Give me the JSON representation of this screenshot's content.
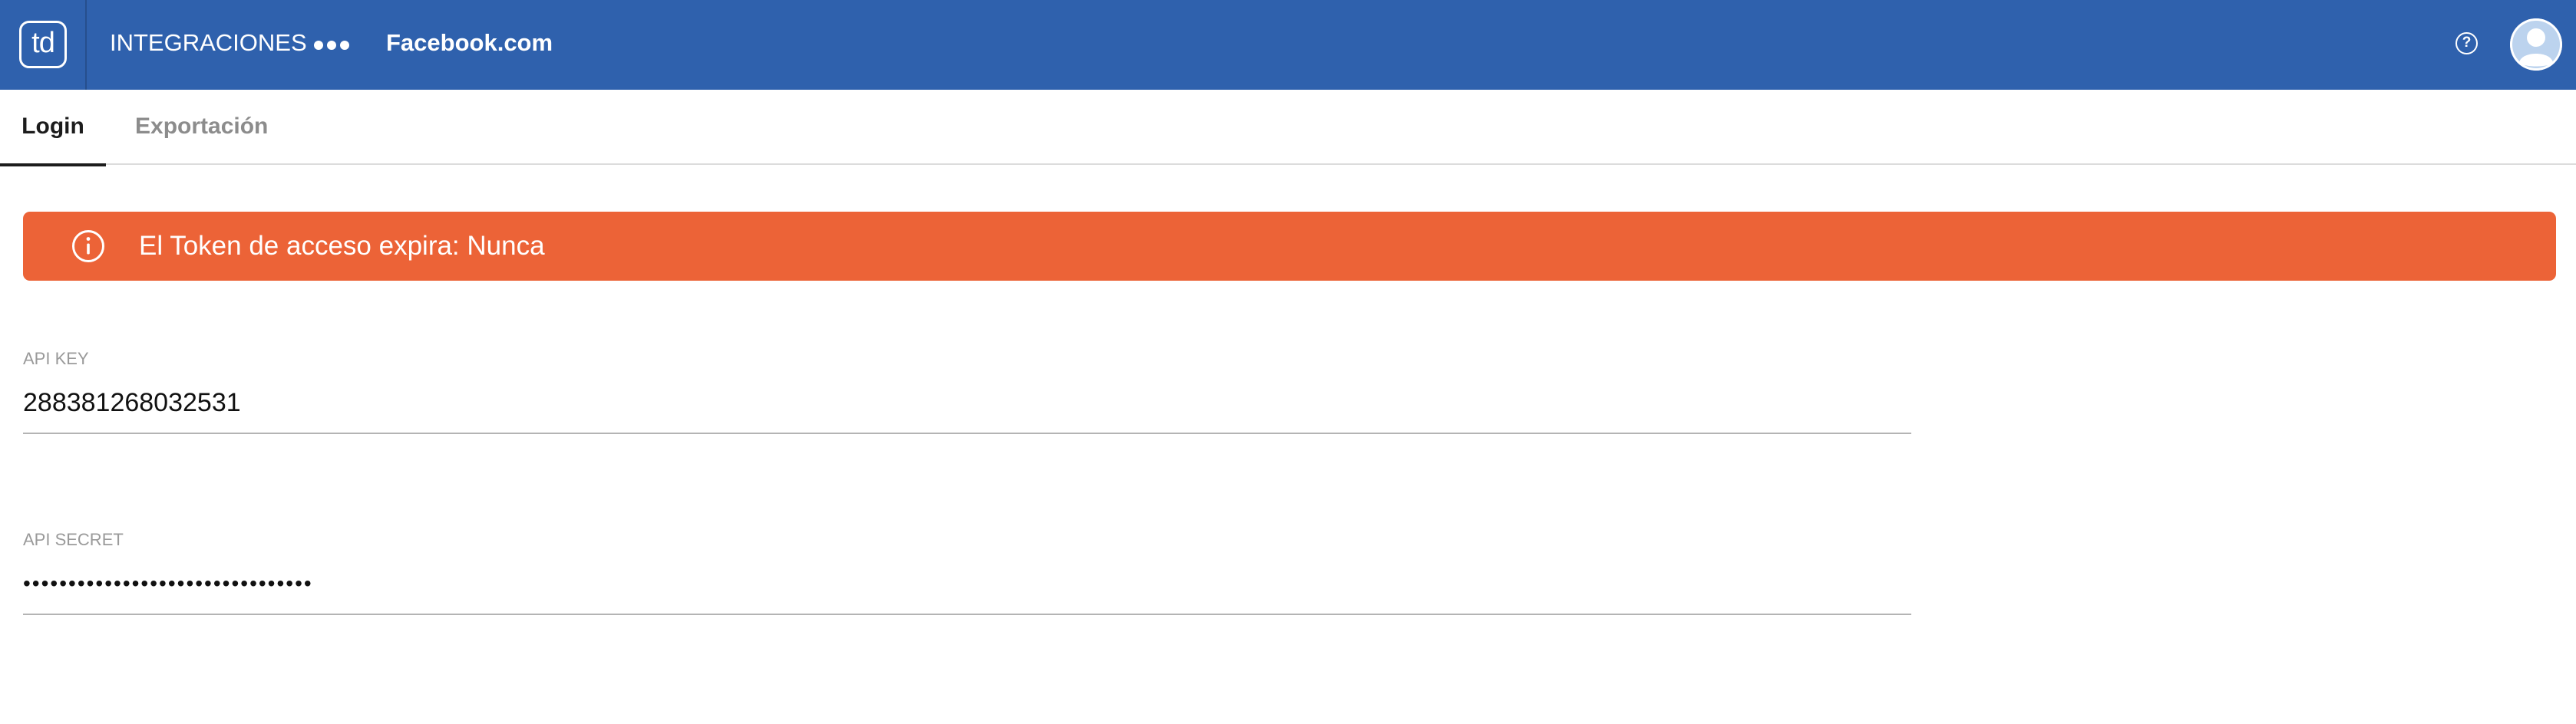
{
  "topbar": {
    "logo_text": "td",
    "breadcrumb": {
      "integraciones": "INTEGRACIONES",
      "current": "Facebook.com"
    },
    "background_color": "#2f61ad",
    "help_icon": "question-circle-icon",
    "avatar_icon": "user-avatar-icon"
  },
  "tabs": [
    {
      "label": "Login",
      "active": true
    },
    {
      "label": "Exportación",
      "active": false
    }
  ],
  "alert": {
    "icon": "info-circle-icon",
    "text": "El Token de acceso expira: Nunca",
    "color": "#ec6337"
  },
  "fields": {
    "api_key": {
      "label": "API KEY",
      "value": "288381268032531"
    },
    "api_secret": {
      "label": "API SECRET",
      "value": "••••••••••••••••••••••••••••••••"
    }
  }
}
